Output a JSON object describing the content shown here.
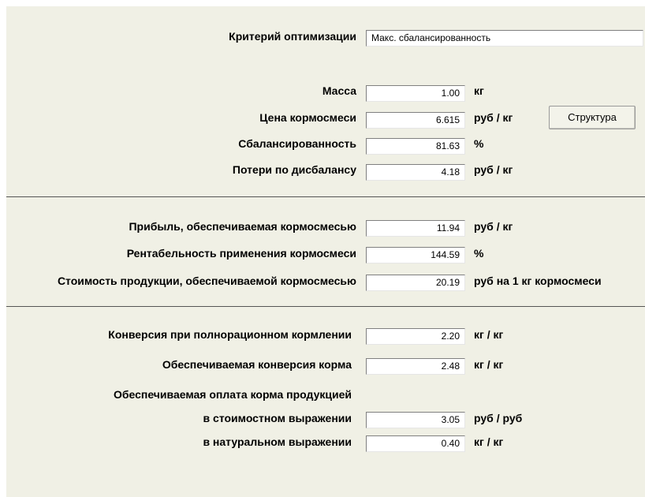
{
  "criterion": {
    "label": "Критерий оптимизации",
    "value": "Макс. сбалансированность"
  },
  "mass": {
    "label": "Масса",
    "value": "1.00",
    "unit": "кг"
  },
  "price": {
    "label": "Цена кормосмеси",
    "value": "6.615",
    "unit": "руб / кг"
  },
  "structure_button": "Структура",
  "balance": {
    "label": "Сбалансированность",
    "value": "81.63",
    "unit": "%"
  },
  "losses": {
    "label": "Потери по дисбалансу",
    "value": "4.18",
    "unit": "руб / кг"
  },
  "profit": {
    "label": "Прибыль, обеспечиваемая кормосмесью",
    "value": "11.94",
    "unit": "руб / кг"
  },
  "profitability": {
    "label": "Рентабельность применения кормосмеси",
    "value": "144.59",
    "unit": "%"
  },
  "product_cost": {
    "label": "Стоимость продукции, обеспечиваемой кормосмесью",
    "value": "20.19",
    "unit": "руб на 1 кг кормосмеси"
  },
  "conversion_full": {
    "label": "Конверсия при полнорационном кормлении",
    "value": "2.20",
    "unit": "кг / кг"
  },
  "conversion_provided": {
    "label": "Обеспечиваемая конверсия корма",
    "value": "2.48",
    "unit": "кг / кг"
  },
  "payment_heading": "Обеспечиваемая оплата корма продукцией",
  "payment_value": {
    "label": "в стоимостном выражении",
    "value": "3.05",
    "unit": "руб / руб"
  },
  "payment_natural": {
    "label": "в натуральном выражении",
    "value": "0.40",
    "unit": "кг / кг"
  }
}
